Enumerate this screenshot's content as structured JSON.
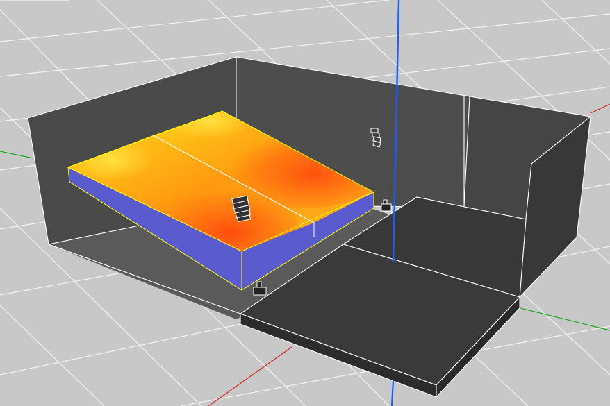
{
  "viewer": {
    "background_color": "#c8c8c8",
    "grid_color": "#f2f2f2",
    "axis_colors": {
      "x": "#dd2222",
      "y": "#22aa22",
      "z": "#1a5cff"
    },
    "room": {
      "wall_color": "#4a4a4a",
      "floor_color": "#5a5a5a",
      "stage_color": "#3b3b3b",
      "edge_color": "#ffffff"
    },
    "audience_area": {
      "heatmap_colors": [
        "#ffd21a",
        "#ff9a10",
        "#ff5a10"
      ],
      "side_color": "#5b5bd0",
      "outline_color": "#ffff00"
    },
    "icons": [
      "speaker-array-icon",
      "speaker-array-icon",
      "subwoofer-icon",
      "subwoofer-icon"
    ]
  }
}
